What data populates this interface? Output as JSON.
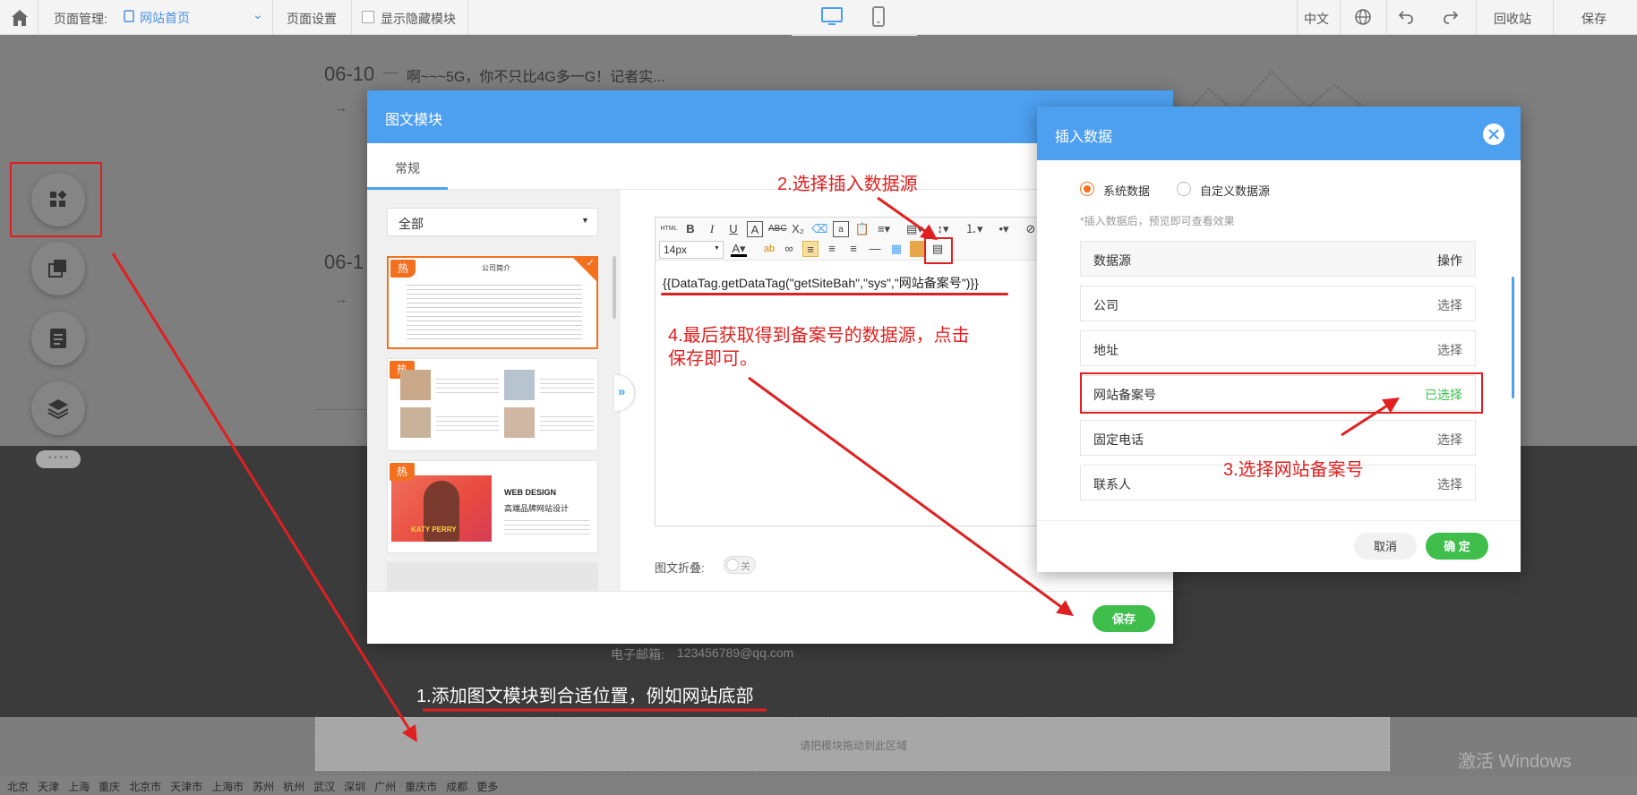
{
  "topbar": {
    "page_manage_label": "页面管理:",
    "current_page": "网站首页",
    "page_settings": "页面设置",
    "show_hidden": "显示隐藏模块",
    "lang": "中文",
    "recycle": "回收站",
    "save": "保存"
  },
  "background": {
    "news1_date": "06-10",
    "news1_title": "啊~~~5G，你不只比4G多一G！记者实...",
    "news2_date": "06-1",
    "email_label": "电子邮箱:",
    "email_value": "123456789@qq.com",
    "drop_hint": "请把模块拖动到此区域",
    "cities": [
      "北京",
      "天津",
      "上海",
      "重庆",
      "北京市",
      "天津市",
      "上海市",
      "苏州",
      "杭州",
      "武汉",
      "深圳",
      "广州",
      "重庆市",
      "成都",
      "更多"
    ],
    "watermark": "激活 Windows"
  },
  "dialog_module": {
    "title": "图文模块",
    "tab_general": "常规",
    "category_select": "全部",
    "hot_badge": "热",
    "tpl1_title": "公司简介",
    "tpl3_line1": "WEB DESIGN",
    "tpl3_line2": "高端品牌网站设计",
    "tpl3_logo": "KATY PERRY",
    "font_size": "14px",
    "editor_content": "{{DataTag.getDataTag(\"getSiteBah\",\"sys\",\"网站备案号\")}}",
    "fold_label": "图文折叠:",
    "fold_toggle": "关",
    "save_button": "保存"
  },
  "dialog_insert": {
    "title": "插入数据",
    "radio_system": "系统数据",
    "radio_custom": "自定义数据源",
    "hint": "*插入数据后，预览即可查看效果",
    "header_source": "数据源",
    "header_action": "操作",
    "rows": [
      {
        "label": "公司",
        "action": "选择"
      },
      {
        "label": "地址",
        "action": "选择"
      },
      {
        "label": "网站备案号",
        "action": "已选择"
      },
      {
        "label": "固定电话",
        "action": "选择"
      },
      {
        "label": "联系人",
        "action": "选择"
      }
    ],
    "cancel": "取消",
    "confirm": "确 定"
  },
  "annotations": {
    "step1": "1.添加图文模块到合适位置，例如网站底部",
    "step2": "2.选择插入数据源",
    "step3": "3.选择网站备案号",
    "step4_line1": "4.最后获取得到备案号的数据源，点击",
    "step4_line2": "保存即可。"
  },
  "colors": {
    "primary_blue": "#4d9ff0",
    "green": "#3fbe4c",
    "orange": "#f2701e",
    "annotation_red": "#e02020"
  }
}
